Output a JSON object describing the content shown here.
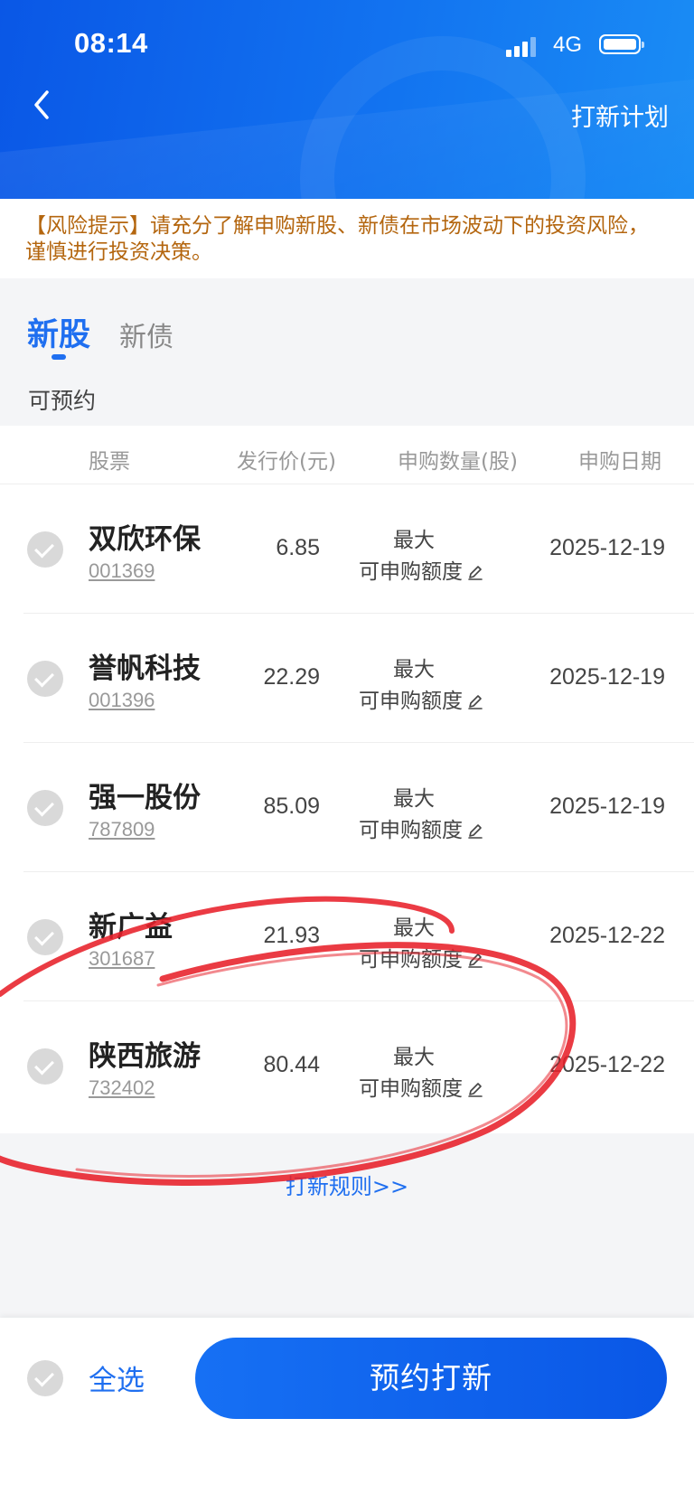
{
  "status_bar": {
    "time": "08:14",
    "network": "4G"
  },
  "header": {
    "plan_link": "打新计划"
  },
  "risk_notice": "【风险提示】请充分了解申购新股、新债在市场波动下的投资风险，谨慎进行投资决策。",
  "tabs": [
    {
      "label": "新股",
      "active": true
    },
    {
      "label": "新债",
      "active": false
    }
  ],
  "section_title": "可预约",
  "table": {
    "headers": [
      "股票",
      "发行价(元)",
      "申购数量(股)",
      "申购日期"
    ],
    "rows": [
      {
        "name": "双欣环保",
        "code": "001369",
        "price": "6.85",
        "qty_line1": "最大",
        "qty_line2": "可申购额度",
        "date": "2025-12-19"
      },
      {
        "name": "誉帆科技",
        "code": "001396",
        "price": "22.29",
        "qty_line1": "最大",
        "qty_line2": "可申购额度",
        "date": "2025-12-19"
      },
      {
        "name": "强一股份",
        "code": "787809",
        "price": "85.09",
        "qty_line1": "最大",
        "qty_line2": "可申购额度",
        "date": "2025-12-19"
      },
      {
        "name": "新广益",
        "code": "301687",
        "price": "21.93",
        "qty_line1": "最大",
        "qty_line2": "可申购额度",
        "date": "2025-12-22"
      },
      {
        "name": "陕西旅游",
        "code": "732402",
        "price": "80.44",
        "qty_line1": "最大",
        "qty_line2": "可申购额度",
        "date": "2025-12-22"
      }
    ]
  },
  "rules_link": "打新规则>>",
  "bottom": {
    "select_all": "全选",
    "reserve_button": "预约打新"
  },
  "colors": {
    "accent": "#1f6ff0",
    "risk_text": "#b4660f",
    "annotation": "#e8202a"
  }
}
